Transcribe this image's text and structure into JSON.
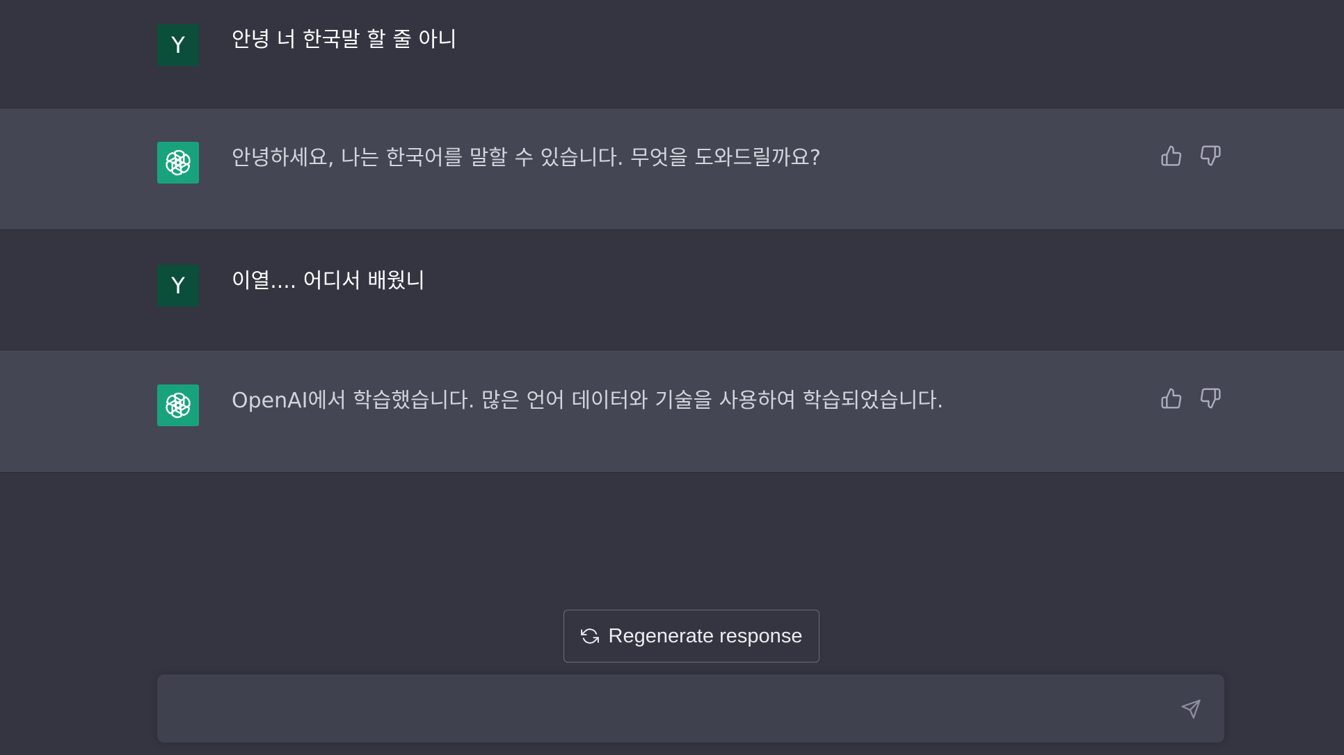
{
  "conversation": {
    "messages": [
      {
        "role": "user",
        "avatar_letter": "Y",
        "text": "안녕 너 한국말 할 줄 아니"
      },
      {
        "role": "assistant",
        "avatar_icon": "openai-logo-icon",
        "text": "안녕하세요, 나는 한국어를 말할 수 있습니다. 무엇을 도와드릴까요?"
      },
      {
        "role": "user",
        "avatar_letter": "Y",
        "text": "이열.... 어디서 배웠니"
      },
      {
        "role": "assistant",
        "avatar_icon": "openai-logo-icon",
        "text": "OpenAI에서 학습했습니다. 많은 언어 데이터와 기술을 사용하여 학습되었습니다."
      }
    ],
    "feedback_icons": [
      "thumbs-up-icon",
      "thumbs-down-icon"
    ]
  },
  "regenerate": {
    "label": "Regenerate response",
    "icon": "refresh-icon"
  },
  "composer": {
    "placeholder": "",
    "value": "",
    "send_icon": "send-icon"
  },
  "colors": {
    "background": "#343541",
    "assistant_row": "#444654",
    "user_avatar": "#0b4f3a",
    "assistant_avatar": "#19a37d",
    "composer": "#40414f"
  }
}
